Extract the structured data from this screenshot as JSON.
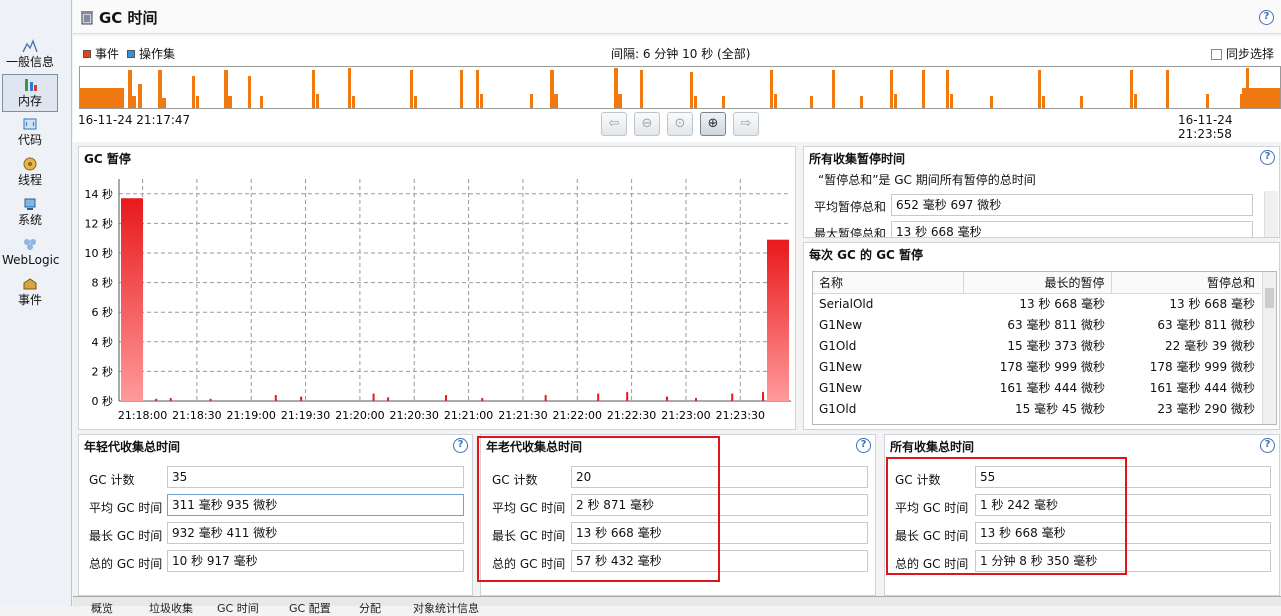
{
  "nav": {
    "items": [
      {
        "label": "一般信息"
      },
      {
        "label": "内存"
      },
      {
        "label": "代码"
      },
      {
        "label": "线程"
      },
      {
        "label": "系统"
      },
      {
        "label": "WebLogic"
      },
      {
        "label": "事件"
      }
    ]
  },
  "header": {
    "title": "GC 时间",
    "help": "?"
  },
  "timeline": {
    "legend_events": "事件",
    "legend_opsets": "操作集",
    "interval": "间隔: 6 分钟 10 秒 (全部)",
    "sync_label": "同步选择",
    "start_time": "16-11-24 21:17:47",
    "end_time": "16-11-24 21:23:58",
    "colors": {
      "events": "#e8401c",
      "opsets": "#3a8fd6",
      "bars": "#f07a10"
    }
  },
  "gc_pause": {
    "title": "GC 暂停",
    "chart_data": {
      "type": "bar",
      "title": "GC 暂停",
      "y_ticks": [
        "0 秒",
        "2 秒",
        "4 秒",
        "6 秒",
        "8 秒",
        "10 秒",
        "12 秒",
        "14 秒"
      ],
      "x_ticks": [
        "21:18:00",
        "21:18:30",
        "21:19:00",
        "21:19:30",
        "21:20:00",
        "21:20:30",
        "21:21:00",
        "21:21:30",
        "21:22:00",
        "21:22:30",
        "21:23:00",
        "21:23:30"
      ],
      "ylim": [
        0,
        15
      ],
      "y_unit": "秒",
      "grid": true,
      "bar_color": "#e8191c",
      "x_seconds_from_21_17_47": [
        0,
        20,
        28,
        50,
        86,
        100,
        140,
        148,
        180,
        200,
        235,
        264,
        280,
        302,
        318,
        338,
        355,
        363
      ],
      "values": [
        13.7,
        0.15,
        0.2,
        0.15,
        0.4,
        0.3,
        0.5,
        0.25,
        0.4,
        0.2,
        0.4,
        0.5,
        0.6,
        0.3,
        0.2,
        0.5,
        0.6,
        10.9
      ]
    }
  },
  "all_pause_time": {
    "title": "所有收集暂停时间",
    "desc": "“暂停总和”是 GC 期间所有暂停的总时间",
    "avg_label": "平均暂停总和",
    "avg_value": "652 毫秒 697 微秒",
    "max_label": "最大暂停总和",
    "max_value": "13 秒 668 毫秒"
  },
  "per_gc_pause": {
    "title": "每次 GC 的 GC 暂停",
    "columns": [
      "名称",
      "最长的暂停",
      "暂停总和"
    ],
    "rows": [
      [
        "SerialOld",
        "13 秒 668 毫秒",
        "13 秒 668 毫秒"
      ],
      [
        "G1New",
        "63 毫秒 811 微秒",
        "63 毫秒 811 微秒"
      ],
      [
        "G1Old",
        "15 毫秒 373 微秒",
        "22 毫秒 39 微秒"
      ],
      [
        "G1New",
        "178 毫秒 999 微秒",
        "178 毫秒 999 微秒"
      ],
      [
        "G1New",
        "161 毫秒 444 微秒",
        "161 毫秒 444 微秒"
      ],
      [
        "G1Old",
        "15 毫秒 45 微秒",
        "23 毫秒 290 微秒"
      ]
    ]
  },
  "young_gc": {
    "title": "年轻代收集总时间",
    "count_label": "GC 计数",
    "count": "35",
    "avg_label": "平均 GC 时间",
    "avg": "311 毫秒 935 微秒",
    "max_label": "最长 GC 时间",
    "max": "932 毫秒 411 微秒",
    "total_label": "总的 GC 时间",
    "total": "10 秒 917 毫秒"
  },
  "old_gc": {
    "title": "年老代收集总时间",
    "count_label": "GC 计数",
    "count": "20",
    "avg_label": "平均 GC 时间",
    "avg": "2 秒 871 毫秒",
    "max_label": "最长 GC 时间",
    "max": "13 秒 668 毫秒",
    "total_label": "总的 GC 时间",
    "total": "57 秒 432 毫秒"
  },
  "all_gc": {
    "title": "所有收集总时间",
    "count_label": "GC 计数",
    "count": "55",
    "avg_label": "平均 GC 时间",
    "avg": "1 秒 242 毫秒",
    "max_label": "最长 GC 时间",
    "max": "13 秒 668 毫秒",
    "total_label": "总的 GC 时间",
    "total": "1 分钟 8 秒 350 毫秒"
  },
  "bottom_tabs": [
    "概览",
    "垃圾收集",
    "GC 时间",
    "GC 配置",
    "分配",
    "对象统计信息"
  ]
}
